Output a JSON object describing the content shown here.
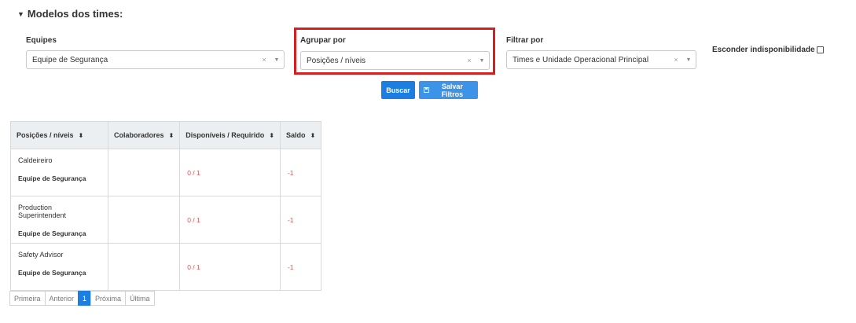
{
  "section": {
    "title": "Modelos dos times:",
    "caret": "▼"
  },
  "filters": {
    "teams": {
      "label": "Equipes",
      "value": "Equipe de Segurança"
    },
    "group_by": {
      "label": "Agrupar por",
      "value": "Posições / níveis"
    },
    "filter_by": {
      "label": "Filtrar por",
      "value": "Times e Unidade Operacional Principal"
    },
    "hide_unavailability": {
      "label": "Esconder indisponibilidade",
      "checked": false
    },
    "clear_glyph": "×",
    "arrow_glyph": "▼"
  },
  "buttons": {
    "search": "Buscar",
    "save_filters": "Salvar Filtros"
  },
  "table": {
    "headers": [
      "Posições / níveis",
      "Colaboradores",
      "Disponíveis / Requirido",
      "Saldo"
    ],
    "sort_glyph": "⬍",
    "rows": [
      {
        "position": "Caldeireiro",
        "team": "Equipe de Segurança",
        "collaborators": "",
        "available": "0 / 1",
        "balance": "-1"
      },
      {
        "position": "Production Superintendent",
        "team": "Equipe de Segurança",
        "collaborators": "",
        "available": "0 / 1",
        "balance": "-1"
      },
      {
        "position": "Safety Advisor",
        "team": "Equipe de Segurança",
        "collaborators": "",
        "available": "0 / 1",
        "balance": "-1"
      }
    ]
  },
  "pagination": {
    "first": "Primeira",
    "previous": "Anterior",
    "current": "1",
    "next": "Próxima",
    "last": "Última"
  },
  "colors": {
    "highlight": "#d42020",
    "primary": "#1b7ee0",
    "negative": "#e44d4d"
  }
}
